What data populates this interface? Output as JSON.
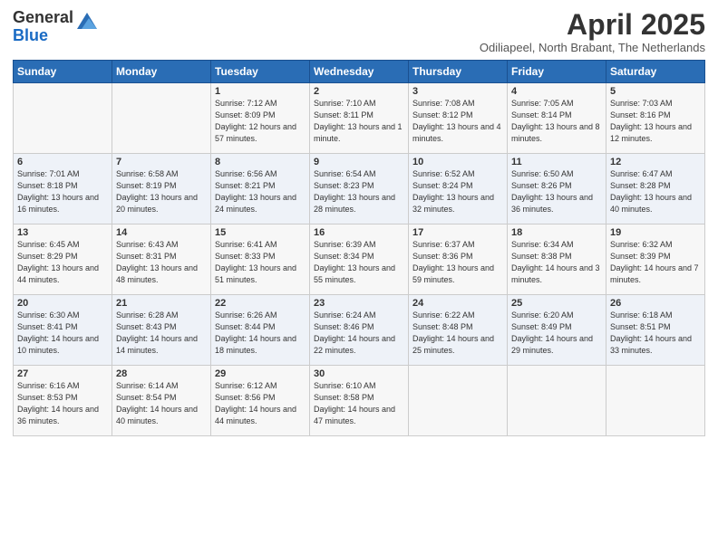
{
  "header": {
    "logo_general": "General",
    "logo_blue": "Blue",
    "month_title": "April 2025",
    "subtitle": "Odiliapeel, North Brabant, The Netherlands"
  },
  "days_of_week": [
    "Sunday",
    "Monday",
    "Tuesday",
    "Wednesday",
    "Thursday",
    "Friday",
    "Saturday"
  ],
  "weeks": [
    [
      {
        "day": "",
        "info": ""
      },
      {
        "day": "",
        "info": ""
      },
      {
        "day": "1",
        "info": "Sunrise: 7:12 AM\nSunset: 8:09 PM\nDaylight: 12 hours and 57 minutes."
      },
      {
        "day": "2",
        "info": "Sunrise: 7:10 AM\nSunset: 8:11 PM\nDaylight: 13 hours and 1 minute."
      },
      {
        "day": "3",
        "info": "Sunrise: 7:08 AM\nSunset: 8:12 PM\nDaylight: 13 hours and 4 minutes."
      },
      {
        "day": "4",
        "info": "Sunrise: 7:05 AM\nSunset: 8:14 PM\nDaylight: 13 hours and 8 minutes."
      },
      {
        "day": "5",
        "info": "Sunrise: 7:03 AM\nSunset: 8:16 PM\nDaylight: 13 hours and 12 minutes."
      }
    ],
    [
      {
        "day": "6",
        "info": "Sunrise: 7:01 AM\nSunset: 8:18 PM\nDaylight: 13 hours and 16 minutes."
      },
      {
        "day": "7",
        "info": "Sunrise: 6:58 AM\nSunset: 8:19 PM\nDaylight: 13 hours and 20 minutes."
      },
      {
        "day": "8",
        "info": "Sunrise: 6:56 AM\nSunset: 8:21 PM\nDaylight: 13 hours and 24 minutes."
      },
      {
        "day": "9",
        "info": "Sunrise: 6:54 AM\nSunset: 8:23 PM\nDaylight: 13 hours and 28 minutes."
      },
      {
        "day": "10",
        "info": "Sunrise: 6:52 AM\nSunset: 8:24 PM\nDaylight: 13 hours and 32 minutes."
      },
      {
        "day": "11",
        "info": "Sunrise: 6:50 AM\nSunset: 8:26 PM\nDaylight: 13 hours and 36 minutes."
      },
      {
        "day": "12",
        "info": "Sunrise: 6:47 AM\nSunset: 8:28 PM\nDaylight: 13 hours and 40 minutes."
      }
    ],
    [
      {
        "day": "13",
        "info": "Sunrise: 6:45 AM\nSunset: 8:29 PM\nDaylight: 13 hours and 44 minutes."
      },
      {
        "day": "14",
        "info": "Sunrise: 6:43 AM\nSunset: 8:31 PM\nDaylight: 13 hours and 48 minutes."
      },
      {
        "day": "15",
        "info": "Sunrise: 6:41 AM\nSunset: 8:33 PM\nDaylight: 13 hours and 51 minutes."
      },
      {
        "day": "16",
        "info": "Sunrise: 6:39 AM\nSunset: 8:34 PM\nDaylight: 13 hours and 55 minutes."
      },
      {
        "day": "17",
        "info": "Sunrise: 6:37 AM\nSunset: 8:36 PM\nDaylight: 13 hours and 59 minutes."
      },
      {
        "day": "18",
        "info": "Sunrise: 6:34 AM\nSunset: 8:38 PM\nDaylight: 14 hours and 3 minutes."
      },
      {
        "day": "19",
        "info": "Sunrise: 6:32 AM\nSunset: 8:39 PM\nDaylight: 14 hours and 7 minutes."
      }
    ],
    [
      {
        "day": "20",
        "info": "Sunrise: 6:30 AM\nSunset: 8:41 PM\nDaylight: 14 hours and 10 minutes."
      },
      {
        "day": "21",
        "info": "Sunrise: 6:28 AM\nSunset: 8:43 PM\nDaylight: 14 hours and 14 minutes."
      },
      {
        "day": "22",
        "info": "Sunrise: 6:26 AM\nSunset: 8:44 PM\nDaylight: 14 hours and 18 minutes."
      },
      {
        "day": "23",
        "info": "Sunrise: 6:24 AM\nSunset: 8:46 PM\nDaylight: 14 hours and 22 minutes."
      },
      {
        "day": "24",
        "info": "Sunrise: 6:22 AM\nSunset: 8:48 PM\nDaylight: 14 hours and 25 minutes."
      },
      {
        "day": "25",
        "info": "Sunrise: 6:20 AM\nSunset: 8:49 PM\nDaylight: 14 hours and 29 minutes."
      },
      {
        "day": "26",
        "info": "Sunrise: 6:18 AM\nSunset: 8:51 PM\nDaylight: 14 hours and 33 minutes."
      }
    ],
    [
      {
        "day": "27",
        "info": "Sunrise: 6:16 AM\nSunset: 8:53 PM\nDaylight: 14 hours and 36 minutes."
      },
      {
        "day": "28",
        "info": "Sunrise: 6:14 AM\nSunset: 8:54 PM\nDaylight: 14 hours and 40 minutes."
      },
      {
        "day": "29",
        "info": "Sunrise: 6:12 AM\nSunset: 8:56 PM\nDaylight: 14 hours and 44 minutes."
      },
      {
        "day": "30",
        "info": "Sunrise: 6:10 AM\nSunset: 8:58 PM\nDaylight: 14 hours and 47 minutes."
      },
      {
        "day": "",
        "info": ""
      },
      {
        "day": "",
        "info": ""
      },
      {
        "day": "",
        "info": ""
      }
    ]
  ]
}
